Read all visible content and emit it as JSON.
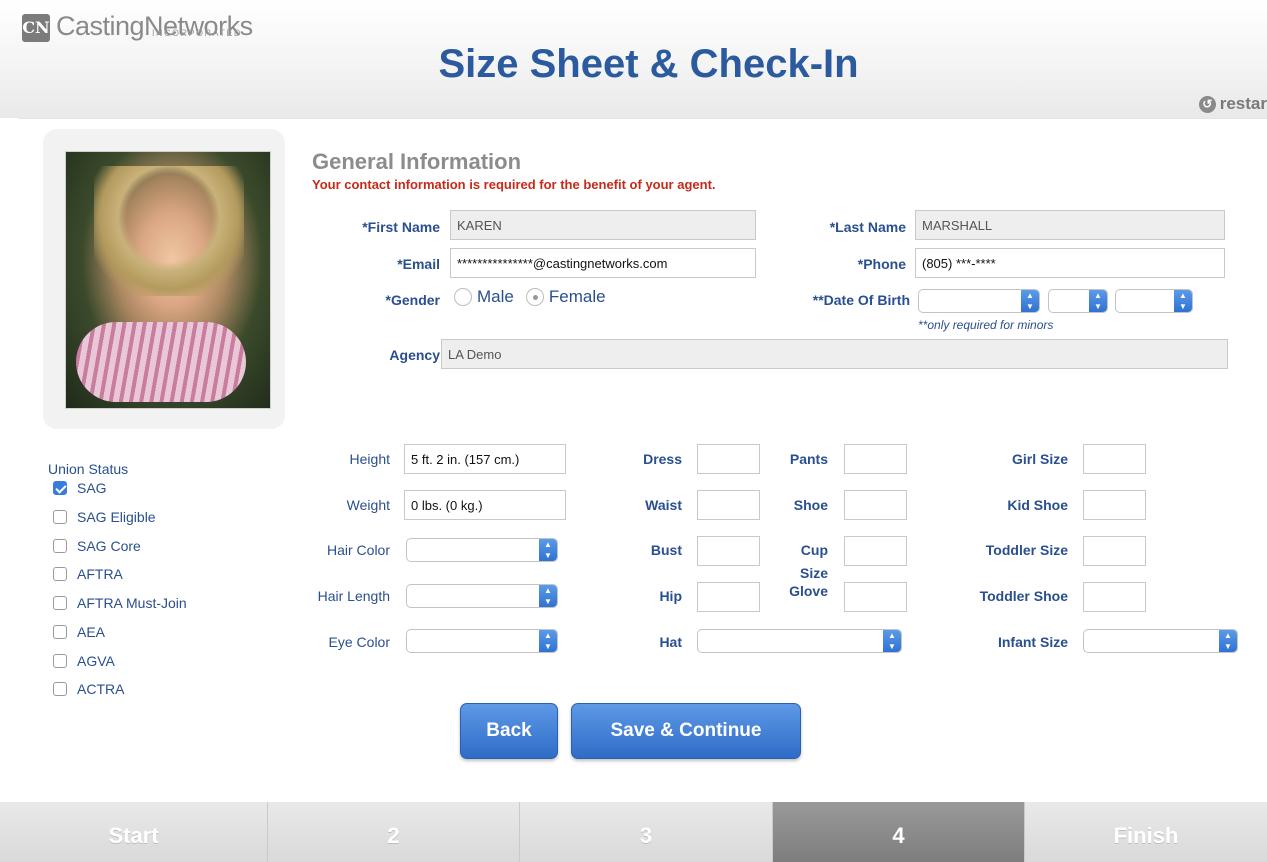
{
  "header": {
    "logo_mark": "CN",
    "logo_text": "CastingNetworks",
    "logo_sub": "INCORPORATED",
    "title": "Size Sheet & Check-In",
    "restart_label": "restar"
  },
  "general": {
    "section_title": "General Information",
    "required_note": "Your contact information is required for the benefit of your agent.",
    "first_name_label": "*First Name",
    "first_name_value": "KAREN",
    "last_name_label": "*Last Name",
    "last_name_value": "MARSHALL",
    "email_label": "*Email",
    "email_value": "***************@castingnetworks.com",
    "phone_label": "*Phone",
    "phone_value": "(805) ***-****",
    "gender_label": "*Gender",
    "gender_options": [
      "Male",
      "Female"
    ],
    "gender_selected": "Female",
    "dob_label": "**Date Of Birth",
    "dob_note": "**only required for minors",
    "agency_label": "Agency",
    "agency_value": "LA Demo"
  },
  "union": {
    "title": "Union Status",
    "items": [
      {
        "label": "SAG",
        "checked": true
      },
      {
        "label": "SAG Eligible",
        "checked": false
      },
      {
        "label": "SAG Core",
        "checked": false
      },
      {
        "label": "AFTRA",
        "checked": false
      },
      {
        "label": "AFTRA Must-Join",
        "checked": false
      },
      {
        "label": "AEA",
        "checked": false
      },
      {
        "label": "AGVA",
        "checked": false
      },
      {
        "label": "ACTRA",
        "checked": false
      }
    ]
  },
  "sizes": {
    "height_label": "Height",
    "height_value": "5 ft. 2 in. (157 cm.)",
    "weight_label": "Weight",
    "weight_value": "0 lbs. (0 kg.)",
    "hair_color_label": "Hair Color",
    "hair_length_label": "Hair Length",
    "eye_color_label": "Eye Color",
    "dress_label": "Dress",
    "waist_label": "Waist",
    "bust_label": "Bust",
    "hip_label": "Hip",
    "hat_label": "Hat",
    "pants_label": "Pants",
    "shoe_label": "Shoe",
    "cup_size_label_1": "Cup",
    "cup_size_label_2": "Size",
    "glove_label": "Glove",
    "girl_size_label": "Girl Size",
    "kid_shoe_label": "Kid Shoe",
    "toddler_size_label": "Toddler Size",
    "toddler_shoe_label": "Toddler Shoe",
    "infant_size_label": "Infant Size"
  },
  "buttons": {
    "back": "Back",
    "save_continue": "Save & Continue"
  },
  "steps": [
    {
      "label": "Start",
      "active": false
    },
    {
      "label": "2",
      "active": false
    },
    {
      "label": "3",
      "active": false
    },
    {
      "label": "4",
      "active": true
    },
    {
      "label": "Finish",
      "active": false
    }
  ]
}
